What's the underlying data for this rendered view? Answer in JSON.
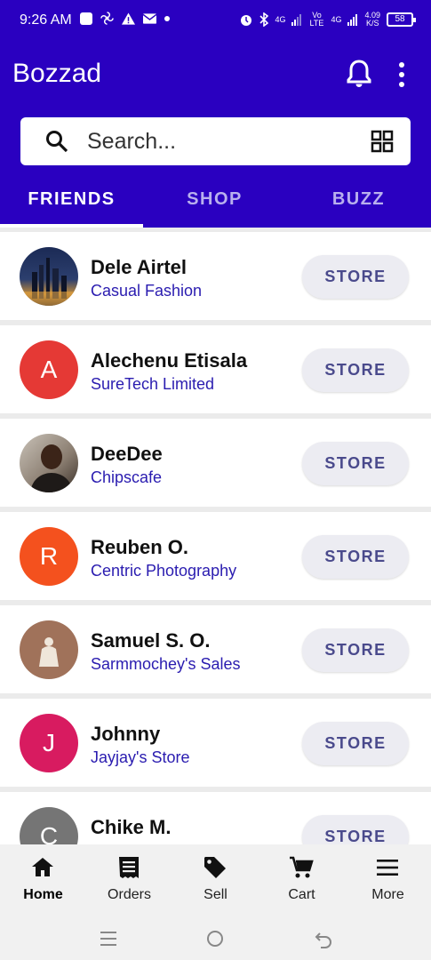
{
  "status_bar": {
    "time": "9:26 AM",
    "net1": "4G",
    "volte": "Vo LTE",
    "net2": "4G",
    "speed": "4.09",
    "speed_unit": "K/S",
    "battery": "58"
  },
  "app": {
    "title": "Bozzad"
  },
  "search": {
    "placeholder": "Search..."
  },
  "tabs": [
    {
      "label": "FRIENDS",
      "active": true
    },
    {
      "label": "SHOP",
      "active": false
    },
    {
      "label": "BUZZ",
      "active": false
    }
  ],
  "store_label": "STORE",
  "friends": [
    {
      "name": "Dele Airtel",
      "store": "Casual Fashion",
      "initial": "",
      "color": "#1d2a4a"
    },
    {
      "name": "Alechenu Etisala",
      "store": "SureTech Limited",
      "initial": "A",
      "color": "#e53935"
    },
    {
      "name": "DeeDee",
      "store": "Chipscafe",
      "initial": "",
      "color": "#6b5a4a"
    },
    {
      "name": "Reuben O.",
      "store": "Centric Photography",
      "initial": "R",
      "color": "#f4511e"
    },
    {
      "name": "Samuel S. O.",
      "store": "Sarmmochey's Sales",
      "initial": "",
      "color": "#a0725a"
    },
    {
      "name": "Johnny",
      "store": "Jayjay's Store",
      "initial": "J",
      "color": "#d81b60"
    },
    {
      "name": "Chike M.",
      "store": "",
      "initial": "C",
      "color": "#757575"
    }
  ],
  "bottom_nav": [
    {
      "label": "Home",
      "icon": "home-icon",
      "active": true
    },
    {
      "label": "Orders",
      "icon": "receipt-icon",
      "active": false
    },
    {
      "label": "Sell",
      "icon": "tag-icon",
      "active": false
    },
    {
      "label": "Cart",
      "icon": "cart-icon",
      "active": false
    },
    {
      "label": "More",
      "icon": "menu-icon",
      "active": false
    }
  ]
}
